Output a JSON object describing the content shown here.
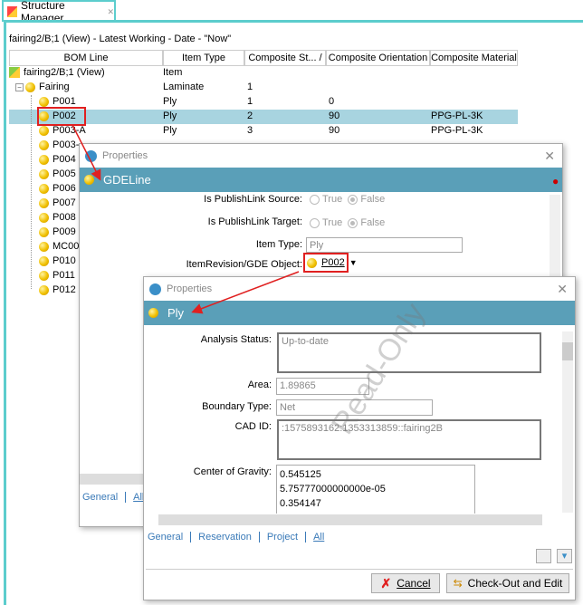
{
  "tab": {
    "title": "Structure Manager",
    "close": "✕"
  },
  "context": "fairing2/B;1 (View) - Latest Working - Date - \"Now\"",
  "columns": [
    "BOM Line",
    "Item Type",
    "Composite St... /",
    "Composite Orientation",
    "Composite Material"
  ],
  "rows": [
    {
      "name": "fairing2/B;1 (View)",
      "type": "Item",
      "seq": "",
      "orient": "",
      "mat": ""
    },
    {
      "name": "Fairing",
      "type": "Laminate",
      "seq": "1",
      "orient": "",
      "mat": ""
    },
    {
      "name": "P001",
      "type": "Ply",
      "seq": "1",
      "orient": "0",
      "mat": ""
    },
    {
      "name": "P002",
      "type": "Ply",
      "seq": "2",
      "orient": "90",
      "mat": "PPG-PL-3K",
      "selected": true
    },
    {
      "name": "P003-A",
      "type": "Ply",
      "seq": "3",
      "orient": "90",
      "mat": "PPG-PL-3K"
    },
    {
      "name": "P003-"
    },
    {
      "name": "P004"
    },
    {
      "name": "P005"
    },
    {
      "name": "P006"
    },
    {
      "name": "P007"
    },
    {
      "name": "P008"
    },
    {
      "name": "P009"
    },
    {
      "name": "MC00"
    },
    {
      "name": "P010"
    },
    {
      "name": "P011"
    },
    {
      "name": "P012"
    }
  ],
  "dialog1": {
    "title": "Properties",
    "header": "GDELine",
    "publish_source_label": "Is PublishLink Source:",
    "publish_target_label": "Is PublishLink Target:",
    "true_label": "True",
    "false_label": "False",
    "item_type_label": "Item Type:",
    "item_type_value": "Ply",
    "gde_label": "ItemRevision/GDE Object:",
    "gde_value": "P002",
    "tabs": [
      "General",
      "All"
    ]
  },
  "dialog2": {
    "title": "Properties",
    "header": "Ply",
    "analysis_label": "Analysis Status:",
    "analysis_value": "Up-to-date",
    "area_label": "Area:",
    "area_value": "1.89865",
    "boundary_label": "Boundary Type:",
    "boundary_value": "Net",
    "cad_label": "CAD ID:",
    "cad_value": ":1575893162:1353313859::fairing2B",
    "cog_label": "Center of Gravity:",
    "cog_values": [
      "0.545125",
      "5.75777000000000e-05",
      "0.354147"
    ],
    "watermark": "Read-Only",
    "tabs": [
      "General",
      "Reservation",
      "Project",
      "All"
    ],
    "cancel": "Cancel",
    "checkout": "Check-Out and Edit"
  },
  "colors": {
    "accent": "#5a9fb8",
    "selection": "#a8d4e0",
    "tab_border": "#5ccdcd",
    "annotation": "#e02020"
  }
}
